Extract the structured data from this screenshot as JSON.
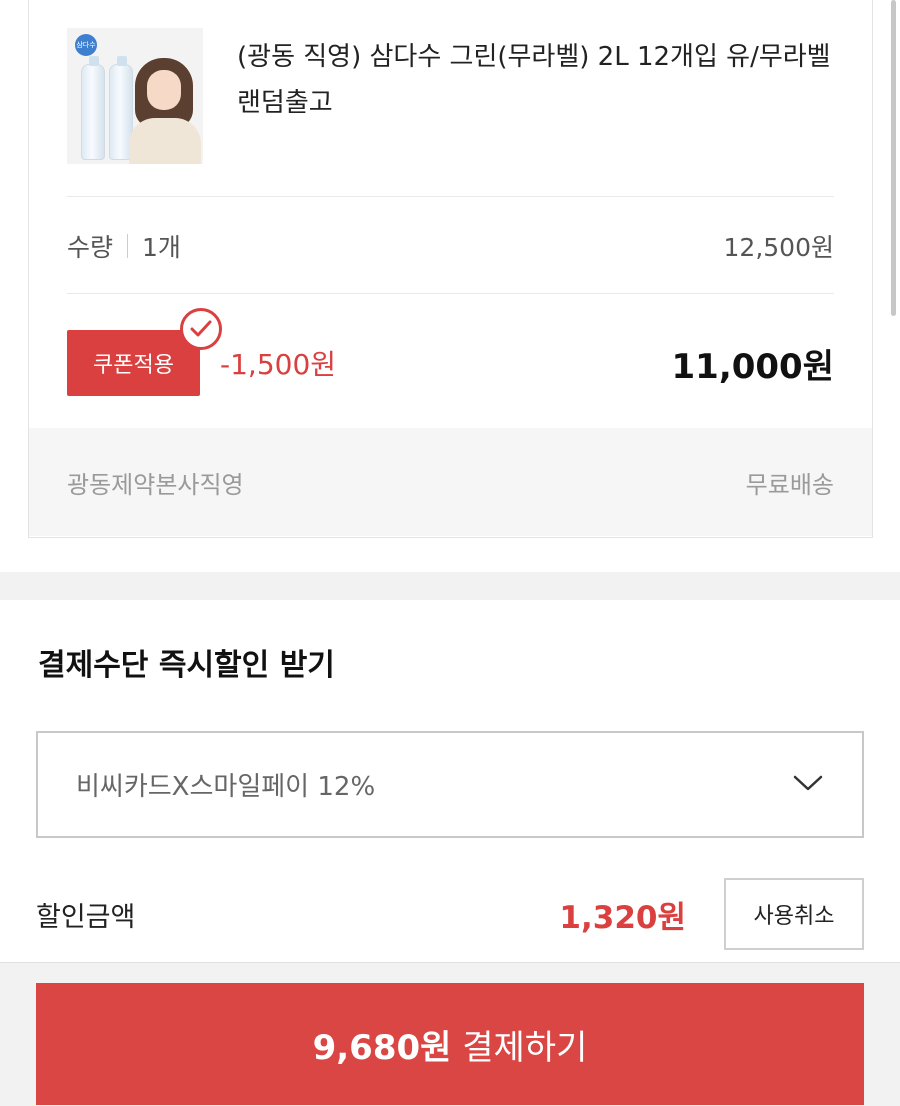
{
  "product": {
    "name": "(광동 직영) 삼다수 그린(무라벨) 2L 12개입 유/무라벨 랜덤출고",
    "thumbnail_badge": "삼다수"
  },
  "quantity": {
    "label": "수량",
    "value": "1개",
    "price": "12,500원"
  },
  "coupon": {
    "button_label": "쿠폰적용",
    "discount": "-1,500원",
    "final_price": "11,000원",
    "applied_icon": "check-circle-icon"
  },
  "seller": {
    "name": "광동제약본사직영",
    "shipping": "무료배송"
  },
  "payment": {
    "section_title": "결제수단 즉시할인 받기",
    "selected_method": "비씨카드X스마일페이 12%",
    "discount_label": "할인금액",
    "discount_amount": "1,320원",
    "cancel_label": "사용취소"
  },
  "checkout": {
    "amount": "9,680원",
    "action": "결제하기"
  },
  "colors": {
    "accent_red": "#d9403f",
    "muted_text": "#9a9a9a"
  }
}
